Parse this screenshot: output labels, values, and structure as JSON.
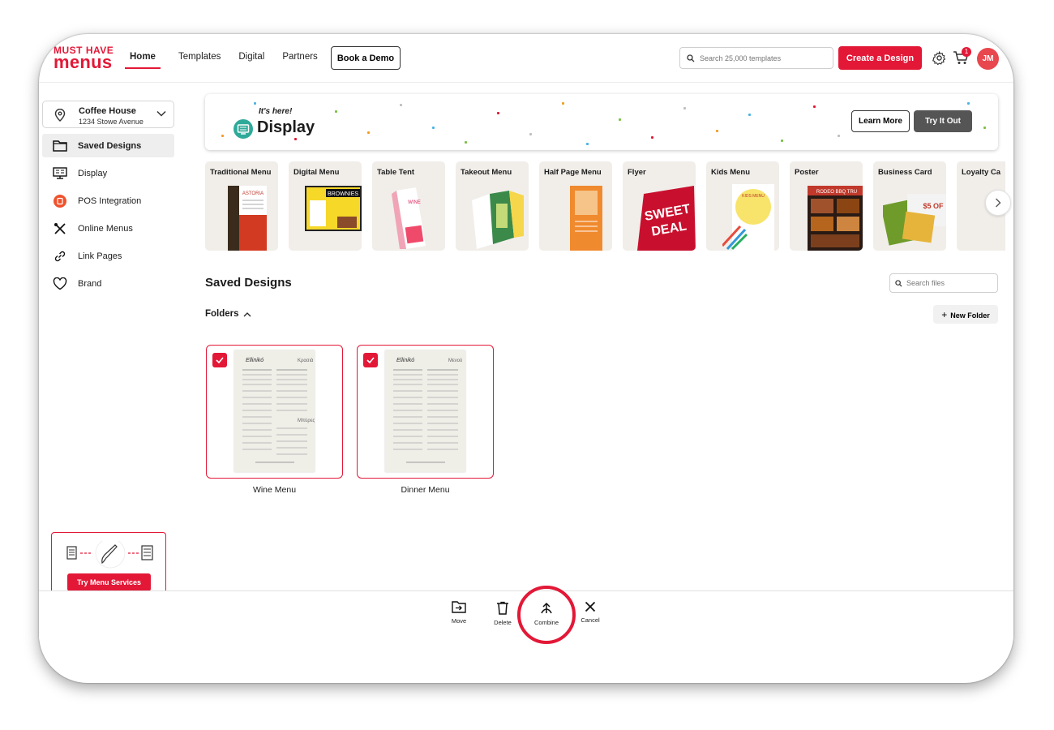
{
  "header": {
    "logo_line1": "MUST HAVE",
    "logo_line2": "menus",
    "nav": [
      "Home",
      "Templates",
      "Digital",
      "Partners"
    ],
    "book_demo": "Book a Demo",
    "search_placeholder": "Search 25,000 templates",
    "create_label": "Create a Design",
    "cart_count": "1",
    "avatar_initials": "JM"
  },
  "sidebar": {
    "location_name": "Coffee House",
    "location_address": "1234 Stowe Avenue",
    "items": [
      {
        "label": "Saved Designs",
        "icon": "folder-icon"
      },
      {
        "label": "Display",
        "icon": "monitor-icon"
      },
      {
        "label": "POS Integration",
        "icon": "pos-icon"
      },
      {
        "label": "Online Menus",
        "icon": "utensils-icon"
      },
      {
        "label": "Link Pages",
        "icon": "link-icon"
      },
      {
        "label": "Brand",
        "icon": "heart-icon"
      }
    ],
    "promo_button": "Try Menu Services"
  },
  "banner": {
    "eyebrow": "It's here!",
    "title": "Display",
    "learn_more": "Learn More",
    "try_it_out": "Try It Out"
  },
  "templates": [
    "Traditional Menu",
    "Digital Menu",
    "Table Tent",
    "Takeout Menu",
    "Half Page Menu",
    "Flyer",
    "Kids Menu",
    "Poster",
    "Business Card",
    "Loyalty Ca"
  ],
  "main": {
    "title": "Saved Designs",
    "search_placeholder": "Search files",
    "folders_label": "Folders",
    "new_folder": "New Folder",
    "designs": [
      {
        "name": "Wine Menu",
        "selected": true
      },
      {
        "name": "Dinner Menu",
        "selected": true
      }
    ]
  },
  "actions": {
    "move": "Move",
    "delete": "Delete",
    "combine": "Combine",
    "cancel": "Cancel"
  },
  "colors": {
    "brand": "#e31837",
    "dark_button": "#555555"
  }
}
